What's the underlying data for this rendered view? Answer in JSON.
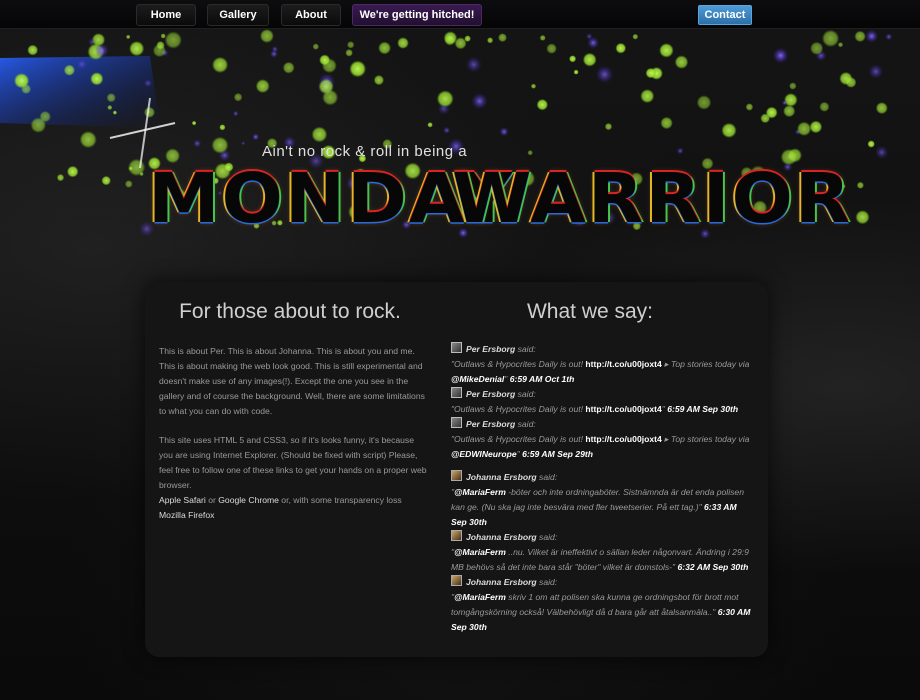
{
  "nav": {
    "items": [
      {
        "label": "Home"
      },
      {
        "label": "Gallery"
      },
      {
        "label": "About"
      },
      {
        "label": "We're getting hitched!"
      }
    ],
    "contact_label": "Contact"
  },
  "hero": {
    "tagline": "Ain't no rock & roll in being a",
    "logo_left": "MONDAY",
    "logo_right": "WARRIOR"
  },
  "about": {
    "title": "For those about to rock.",
    "p1": "This is about Per. This is about Johanna. This is about you and me. This is about making the web look good. This is still experimental and doesn't make use of any images(!). Except the one you see in the gallery and of course the background. Well, there are some limitations to what you can do with code.",
    "p2": "This site uses HTML 5 and CSS3, so if it's looks funny, it's because you are using Internet Explorer. (Should be fixed with script) Please, feel free to follow one of these links to get your hands on a proper web browser.",
    "link_safari": "Apple Safari",
    "or1": " or ",
    "link_chrome": "Google Chrome",
    "or2": " or, with some transparency loss",
    "link_firefox": "Mozilla Firefox"
  },
  "tweets_section": {
    "title": "What we say:",
    "said": " said:",
    "tweets": [
      {
        "author": "Per Ersborg",
        "pre": "\"Outlaws & Hypocrites Daily is out! ",
        "link": "http://t.co/u00joxt4",
        "mid": " ▸ Top stories today via ",
        "mention": "@MikeDenial",
        "post": "\" ",
        "time": "6:59 AM Oct 1th"
      },
      {
        "author": "Per Ersborg",
        "pre": "\"Outlaws & Hypocrites Daily is out! ",
        "link": "http://t.co/u00joxt4",
        "mid": "\" ",
        "mention": "",
        "post": "",
        "time": "6:59 AM Sep 30th"
      },
      {
        "author": "Per Ersborg",
        "pre": "\"Outlaws & Hypocrites Daily is out! ",
        "link": "http://t.co/u00joxt4",
        "mid": " ▸ Top stories today via ",
        "mention": "@EDWINeurope",
        "post": "\" ",
        "time": "6:59 AM Sep 29th"
      },
      {
        "author": "Johanna Ersborg",
        "pre": "\"",
        "link": "",
        "mid": "",
        "mention": "@MariaFerm",
        "post": " -böter och inte ordningaböter. Sistnämnda är det enda polisen kan ge. (Nu ska jag inte besvära med fler tweetserier. På ett tag.)\" ",
        "time": "6:33 AM Sep 30th"
      },
      {
        "author": "Johanna Ersborg",
        "pre": "\"",
        "link": "",
        "mid": "",
        "mention": "@MariaFerm",
        "post": " ..nu. Vilket är ineffektivt o sällan leder någonvart. Ändring i 29:9 MB behövs så det inte bara står \"böter\" vilket är domstols-\" ",
        "time": "6:32 AM Sep 30th"
      },
      {
        "author": "Johanna Ersborg",
        "pre": "\"",
        "link": "",
        "mid": "",
        "mention": "@MariaFerm",
        "post": " skriv 1 om att polisen ska kunna ge ordningsbot för brott mot tomgångskörning också! Välbehövligt då d bara går att åtalsanmäla..\" ",
        "time": "6:30 AM Sep 30th"
      }
    ]
  }
}
